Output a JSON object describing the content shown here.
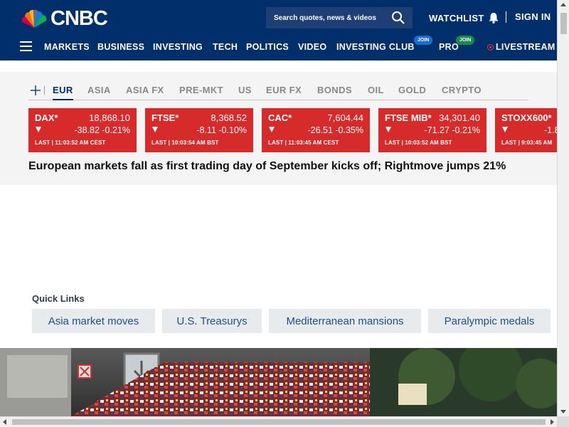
{
  "header": {
    "logo_text": "CNBC",
    "search_placeholder": "Search quotes, news & videos",
    "watchlist_label": "WATCHLIST",
    "signin_label": "SIGN IN",
    "nav": {
      "markets": "MARKETS",
      "business": "BUSINESS",
      "investing": "INVESTING",
      "tech": "TECH",
      "politics": "POLITICS",
      "video": "VIDEO",
      "investing_club": "INVESTING CLUB",
      "investing_club_badge": "JOIN",
      "pro": "PRO",
      "pro_badge": "JOIN",
      "livestream": "LIVESTREAM"
    },
    "colors": {
      "background": "#002f6c",
      "club_badge": "#1a6dd6",
      "pro_badge": "#1a8a4a",
      "live": "#ff2e2e"
    }
  },
  "markets": {
    "tabs": [
      "EUR",
      "ASIA",
      "ASIA FX",
      "PRE-MKT",
      "US",
      "EUR FX",
      "BONDS",
      "OIL",
      "GOLD",
      "CRYPTO"
    ],
    "active_tab": "EUR",
    "cards": [
      {
        "symbol": "DAX*",
        "price": "18,868.10",
        "change": "-38.82",
        "pct": "-0.21%",
        "time": "LAST | 11:03:52 AM CEST"
      },
      {
        "symbol": "FTSE*",
        "price": "8,368.52",
        "change": "-8.11",
        "pct": "-0.10%",
        "time": "LAST | 10:03:54 AM BST"
      },
      {
        "symbol": "CAC*",
        "price": "7,604.44",
        "change": "-26.51",
        "pct": "-0.35%",
        "time": "LAST | 11:03:45 AM CEST"
      },
      {
        "symbol": "FTSE MIB*",
        "price": "34,301.40",
        "change": "-71.27",
        "pct": "-0.21%",
        "time": "LAST | 10:03:52 AM BST"
      },
      {
        "symbol": "STOXX600*",
        "price": "-1.8",
        "change": "",
        "pct": "",
        "time": "LAST | 9:03:45 AM"
      }
    ],
    "down_color": "#d72b2b",
    "headline": "European markets fall as first trading day of September kicks off; Rightmove jumps 21%"
  },
  "quick_links": {
    "title": "Quick Links",
    "items": [
      "Asia market moves",
      "U.S. Treasurys",
      "Mediterranean mansions",
      "Paralympic medals"
    ]
  }
}
